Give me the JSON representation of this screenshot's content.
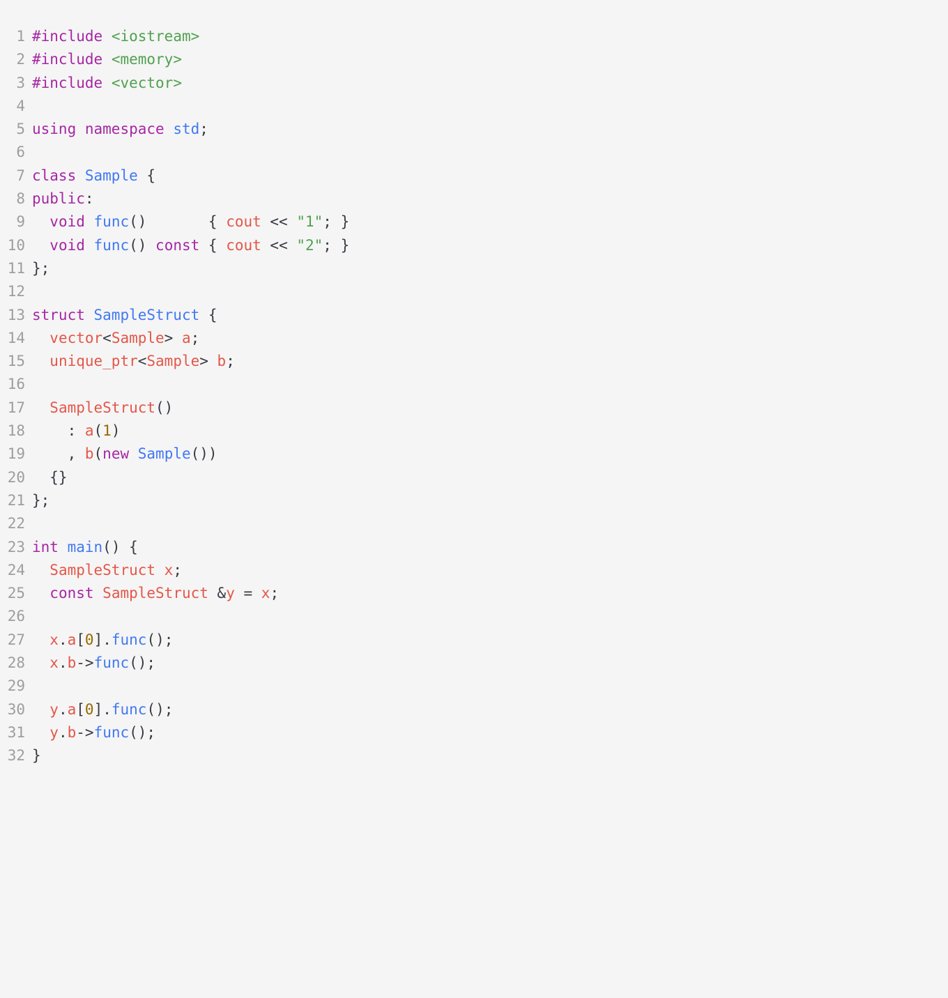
{
  "language": "cpp",
  "theme": "one-light",
  "lines": [
    {
      "n": 1,
      "tokens": [
        {
          "t": "#include",
          "c": "kw"
        },
        {
          "t": " ",
          "c": "pun"
        },
        {
          "t": "<iostream>",
          "c": "str"
        }
      ]
    },
    {
      "n": 2,
      "tokens": [
        {
          "t": "#include",
          "c": "kw"
        },
        {
          "t": " ",
          "c": "pun"
        },
        {
          "t": "<memory>",
          "c": "str"
        }
      ]
    },
    {
      "n": 3,
      "tokens": [
        {
          "t": "#include",
          "c": "kw"
        },
        {
          "t": " ",
          "c": "pun"
        },
        {
          "t": "<vector>",
          "c": "str"
        }
      ]
    },
    {
      "n": 4,
      "tokens": []
    },
    {
      "n": 5,
      "tokens": [
        {
          "t": "using",
          "c": "kw"
        },
        {
          "t": " ",
          "c": "pun"
        },
        {
          "t": "namespace",
          "c": "kw"
        },
        {
          "t": " ",
          "c": "pun"
        },
        {
          "t": "std",
          "c": "cls"
        },
        {
          "t": ";",
          "c": "pun"
        }
      ]
    },
    {
      "n": 6,
      "tokens": []
    },
    {
      "n": 7,
      "tokens": [
        {
          "t": "class",
          "c": "kw"
        },
        {
          "t": " ",
          "c": "pun"
        },
        {
          "t": "Sample",
          "c": "cls"
        },
        {
          "t": " {",
          "c": "pun"
        }
      ]
    },
    {
      "n": 8,
      "tokens": [
        {
          "t": "public",
          "c": "kw"
        },
        {
          "t": ":",
          "c": "pun"
        }
      ]
    },
    {
      "n": 9,
      "tokens": [
        {
          "t": "  ",
          "c": "pun"
        },
        {
          "t": "void",
          "c": "kw"
        },
        {
          "t": " ",
          "c": "pun"
        },
        {
          "t": "func",
          "c": "fn"
        },
        {
          "t": "()       { ",
          "c": "pun"
        },
        {
          "t": "cout",
          "c": "var"
        },
        {
          "t": " << ",
          "c": "pun"
        },
        {
          "t": "\"1\"",
          "c": "str"
        },
        {
          "t": "; }",
          "c": "pun"
        }
      ]
    },
    {
      "n": 10,
      "tokens": [
        {
          "t": "  ",
          "c": "pun"
        },
        {
          "t": "void",
          "c": "kw"
        },
        {
          "t": " ",
          "c": "pun"
        },
        {
          "t": "func",
          "c": "fn"
        },
        {
          "t": "() ",
          "c": "pun"
        },
        {
          "t": "const",
          "c": "kw"
        },
        {
          "t": " { ",
          "c": "pun"
        },
        {
          "t": "cout",
          "c": "var"
        },
        {
          "t": " << ",
          "c": "pun"
        },
        {
          "t": "\"2\"",
          "c": "str"
        },
        {
          "t": "; }",
          "c": "pun"
        }
      ]
    },
    {
      "n": 11,
      "tokens": [
        {
          "t": "};",
          "c": "pun"
        }
      ]
    },
    {
      "n": 12,
      "tokens": []
    },
    {
      "n": 13,
      "tokens": [
        {
          "t": "struct",
          "c": "kw"
        },
        {
          "t": " ",
          "c": "pun"
        },
        {
          "t": "SampleStruct",
          "c": "cls"
        },
        {
          "t": " {",
          "c": "pun"
        }
      ]
    },
    {
      "n": 14,
      "tokens": [
        {
          "t": "  ",
          "c": "pun"
        },
        {
          "t": "vector",
          "c": "var"
        },
        {
          "t": "<",
          "c": "pun"
        },
        {
          "t": "Sample",
          "c": "var"
        },
        {
          "t": "> ",
          "c": "pun"
        },
        {
          "t": "a",
          "c": "var"
        },
        {
          "t": ";",
          "c": "pun"
        }
      ]
    },
    {
      "n": 15,
      "tokens": [
        {
          "t": "  ",
          "c": "pun"
        },
        {
          "t": "unique_ptr",
          "c": "var"
        },
        {
          "t": "<",
          "c": "pun"
        },
        {
          "t": "Sample",
          "c": "var"
        },
        {
          "t": "> ",
          "c": "pun"
        },
        {
          "t": "b",
          "c": "var"
        },
        {
          "t": ";",
          "c": "pun"
        }
      ]
    },
    {
      "n": 16,
      "tokens": []
    },
    {
      "n": 17,
      "tokens": [
        {
          "t": "  ",
          "c": "pun"
        },
        {
          "t": "SampleStruct",
          "c": "var"
        },
        {
          "t": "()",
          "c": "pun"
        }
      ]
    },
    {
      "n": 18,
      "tokens": [
        {
          "t": "    : ",
          "c": "pun"
        },
        {
          "t": "a",
          "c": "var"
        },
        {
          "t": "(",
          "c": "pun"
        },
        {
          "t": "1",
          "c": "num"
        },
        {
          "t": ")",
          "c": "pun"
        }
      ]
    },
    {
      "n": 19,
      "tokens": [
        {
          "t": "    , ",
          "c": "pun"
        },
        {
          "t": "b",
          "c": "var"
        },
        {
          "t": "(",
          "c": "pun"
        },
        {
          "t": "new",
          "c": "kw"
        },
        {
          "t": " ",
          "c": "pun"
        },
        {
          "t": "Sample",
          "c": "cls"
        },
        {
          "t": "())",
          "c": "pun"
        }
      ]
    },
    {
      "n": 20,
      "tokens": [
        {
          "t": "  {}",
          "c": "pun"
        }
      ]
    },
    {
      "n": 21,
      "tokens": [
        {
          "t": "};",
          "c": "pun"
        }
      ]
    },
    {
      "n": 22,
      "tokens": []
    },
    {
      "n": 23,
      "tokens": [
        {
          "t": "int",
          "c": "kw"
        },
        {
          "t": " ",
          "c": "pun"
        },
        {
          "t": "main",
          "c": "fn"
        },
        {
          "t": "() {",
          "c": "pun"
        }
      ]
    },
    {
      "n": 24,
      "tokens": [
        {
          "t": "  ",
          "c": "pun"
        },
        {
          "t": "SampleStruct",
          "c": "var"
        },
        {
          "t": " ",
          "c": "pun"
        },
        {
          "t": "x",
          "c": "var"
        },
        {
          "t": ";",
          "c": "pun"
        }
      ]
    },
    {
      "n": 25,
      "tokens": [
        {
          "t": "  ",
          "c": "pun"
        },
        {
          "t": "const",
          "c": "kw"
        },
        {
          "t": " ",
          "c": "pun"
        },
        {
          "t": "SampleStruct",
          "c": "var"
        },
        {
          "t": " &",
          "c": "pun"
        },
        {
          "t": "y",
          "c": "var"
        },
        {
          "t": " = ",
          "c": "pun"
        },
        {
          "t": "x",
          "c": "var"
        },
        {
          "t": ";",
          "c": "pun"
        }
      ]
    },
    {
      "n": 26,
      "tokens": []
    },
    {
      "n": 27,
      "tokens": [
        {
          "t": "  ",
          "c": "pun"
        },
        {
          "t": "x",
          "c": "var"
        },
        {
          "t": ".",
          "c": "pun"
        },
        {
          "t": "a",
          "c": "var"
        },
        {
          "t": "[",
          "c": "pun"
        },
        {
          "t": "0",
          "c": "num"
        },
        {
          "t": "].",
          "c": "pun"
        },
        {
          "t": "func",
          "c": "fn"
        },
        {
          "t": "();",
          "c": "pun"
        }
      ]
    },
    {
      "n": 28,
      "tokens": [
        {
          "t": "  ",
          "c": "pun"
        },
        {
          "t": "x",
          "c": "var"
        },
        {
          "t": ".",
          "c": "pun"
        },
        {
          "t": "b",
          "c": "var"
        },
        {
          "t": "->",
          "c": "pun"
        },
        {
          "t": "func",
          "c": "fn"
        },
        {
          "t": "();",
          "c": "pun"
        }
      ]
    },
    {
      "n": 29,
      "tokens": []
    },
    {
      "n": 30,
      "tokens": [
        {
          "t": "  ",
          "c": "pun"
        },
        {
          "t": "y",
          "c": "var"
        },
        {
          "t": ".",
          "c": "pun"
        },
        {
          "t": "a",
          "c": "var"
        },
        {
          "t": "[",
          "c": "pun"
        },
        {
          "t": "0",
          "c": "num"
        },
        {
          "t": "].",
          "c": "pun"
        },
        {
          "t": "func",
          "c": "fn"
        },
        {
          "t": "();",
          "c": "pun"
        }
      ]
    },
    {
      "n": 31,
      "tokens": [
        {
          "t": "  ",
          "c": "pun"
        },
        {
          "t": "y",
          "c": "var"
        },
        {
          "t": ".",
          "c": "pun"
        },
        {
          "t": "b",
          "c": "var"
        },
        {
          "t": "->",
          "c": "pun"
        },
        {
          "t": "func",
          "c": "fn"
        },
        {
          "t": "();",
          "c": "pun"
        }
      ]
    },
    {
      "n": 32,
      "tokens": [
        {
          "t": "}",
          "c": "pun"
        }
      ]
    }
  ]
}
